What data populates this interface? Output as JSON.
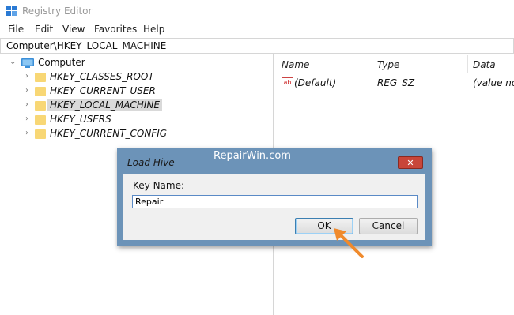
{
  "window": {
    "title": "Registry Editor"
  },
  "menu": [
    "File",
    "Edit",
    "View",
    "Favorites",
    "Help"
  ],
  "address": "Computer\\HKEY_LOCAL_MACHINE",
  "tree": {
    "root": "Computer",
    "items": [
      {
        "label": "HKEY_CLASSES_ROOT"
      },
      {
        "label": "HKEY_CURRENT_USER"
      },
      {
        "label": "HKEY_LOCAL_MACHINE",
        "selected": true
      },
      {
        "label": "HKEY_USERS"
      },
      {
        "label": "HKEY_CURRENT_CONFIG"
      }
    ]
  },
  "list": {
    "columns": [
      "Name",
      "Type",
      "Data"
    ],
    "rows": [
      {
        "icon": "ab",
        "name": "(Default)",
        "type": "REG_SZ",
        "data": "(value not"
      }
    ]
  },
  "dialog": {
    "title": "Load Hive",
    "key_label": "Key Name:",
    "key_value": "Repair",
    "ok_label": "OK",
    "cancel_label": "Cancel"
  },
  "watermark": "RepairWin.com",
  "colors": {
    "selection": "#cce8ff",
    "dialog_frame": "#6c93b8",
    "close": "#c8463a",
    "arrow": "#f08a2c",
    "folder": "#f8d775"
  }
}
